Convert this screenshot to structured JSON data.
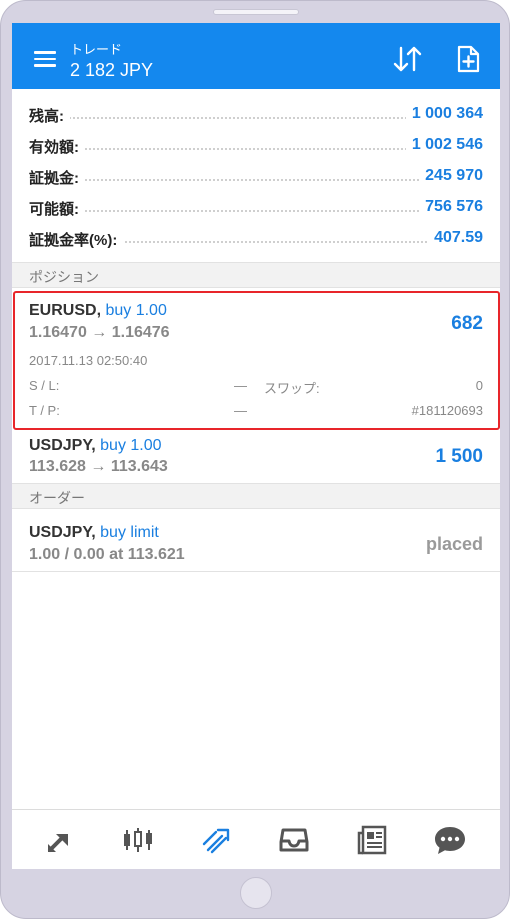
{
  "header": {
    "title": "トレード",
    "subtitle": "2 182 JPY"
  },
  "summary": [
    {
      "label": "残高:",
      "value": "1 000 364"
    },
    {
      "label": "有効額:",
      "value": "1 002 546"
    },
    {
      "label": "証拠金:",
      "value": "245 970"
    },
    {
      "label": "可能額:",
      "value": "756 576"
    },
    {
      "label": "証拠金率(%):",
      "value": "407.59"
    }
  ],
  "positions_section": "ポジション",
  "positions": [
    {
      "symbol": "EURUSD,",
      "side": "buy 1.00",
      "prices": "1.16470 → 1.16476",
      "profit": "682",
      "time": "2017.11.13 02:50:40",
      "sl_label": "S / L:",
      "sl_value": "—",
      "swap_label": "スワップ:",
      "swap_value": "0",
      "tp_label": "T / P:",
      "tp_value": "—",
      "ticket": "#181120693"
    },
    {
      "symbol": "USDJPY,",
      "side": "buy 1.00",
      "prices": "113.628 → 113.643",
      "profit": "1 500"
    }
  ],
  "orders_section": "オーダー",
  "orders": [
    {
      "symbol": "USDJPY,",
      "side": "buy limit",
      "detail": "1.00 / 0.00 at 113.621",
      "status": "placed"
    }
  ],
  "nav_icons": [
    "quotes-icon",
    "chart-icon",
    "trade-icon",
    "history-icon",
    "news-icon",
    "chat-icon"
  ],
  "colors": {
    "appbar": "#1488ee",
    "accent": "#1a7fe0",
    "highlight": "#e8252a"
  }
}
